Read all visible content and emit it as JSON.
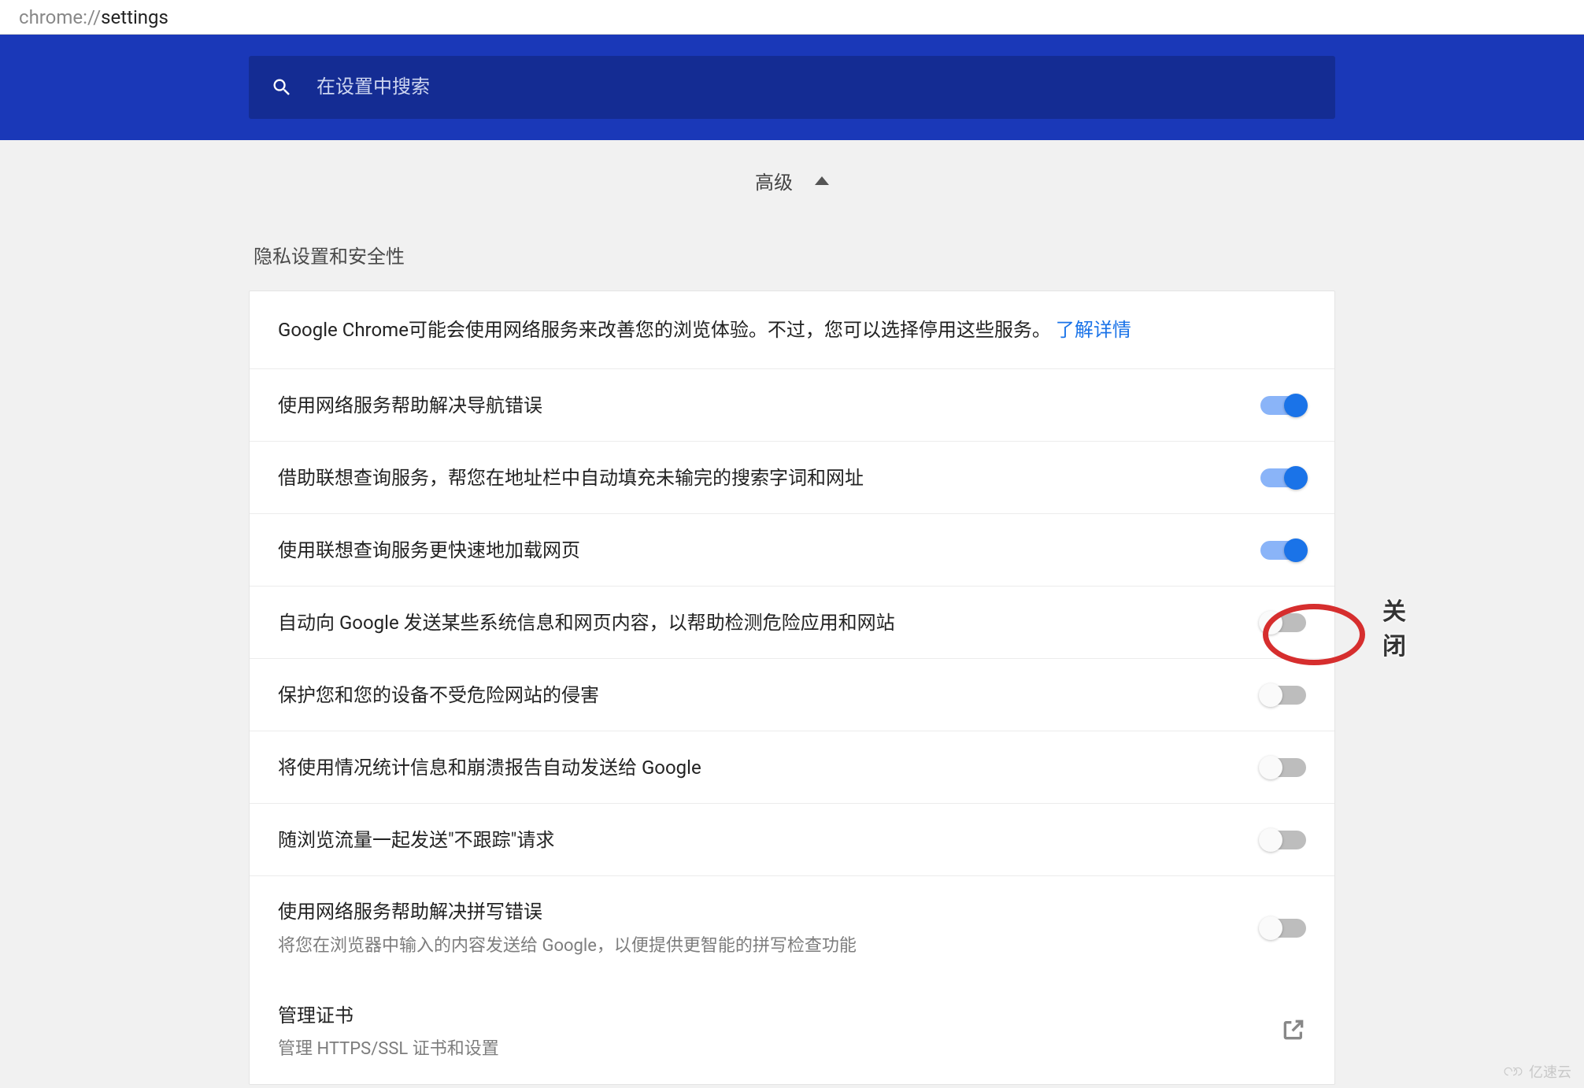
{
  "address_bar": {
    "scheme": "chrome://",
    "path": "settings"
  },
  "search": {
    "placeholder": "在设置中搜索"
  },
  "advanced_label": "高级",
  "section_title": "隐私设置和安全性",
  "intro": {
    "text": "Google Chrome可能会使用网络服务来改善您的浏览体验。不过，您可以选择停用这些服务。",
    "link": "了解详情"
  },
  "rows": [
    {
      "title": "使用网络服务帮助解决导航错误",
      "on": true
    },
    {
      "title": "借助联想查询服务，帮您在地址栏中自动填充未输完的搜索字词和网址",
      "on": true
    },
    {
      "title": "使用联想查询服务更快速地加载网页",
      "on": true
    },
    {
      "title": "自动向 Google 发送某些系统信息和网页内容，以帮助检测危险应用和网站",
      "on": false
    },
    {
      "title": "保护您和您的设备不受危险网站的侵害",
      "on": false
    },
    {
      "title": "将使用情况统计信息和崩溃报告自动发送给 Google",
      "on": false
    },
    {
      "title": "随浏览流量一起发送\"不跟踪\"请求",
      "on": false
    },
    {
      "title": "使用网络服务帮助解决拼写错误",
      "sub": "将您在浏览器中输入的内容发送给 Google，以便提供更智能的拼写检查功能",
      "on": false
    }
  ],
  "cert_row": {
    "title": "管理证书",
    "sub": "管理 HTTPS/SSL 证书和设置"
  },
  "annotation_label": "关闭",
  "watermark": "亿速云"
}
